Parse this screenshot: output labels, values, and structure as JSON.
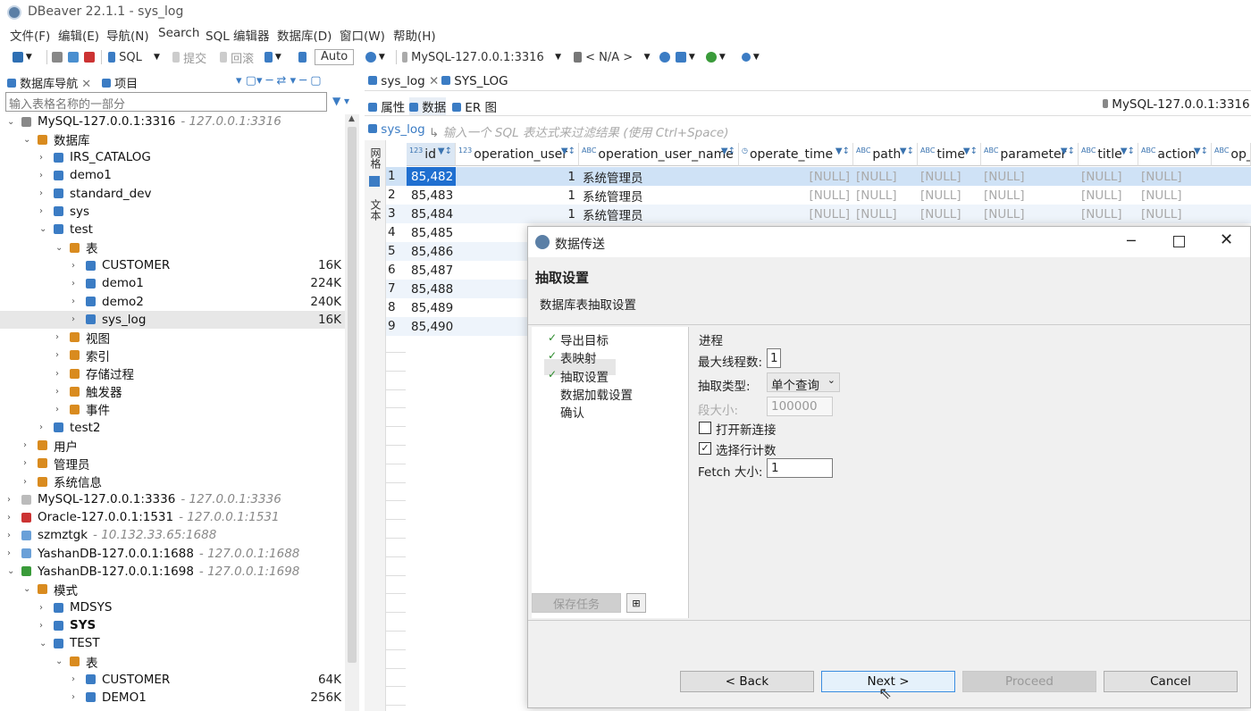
{
  "window": {
    "title": "DBeaver 22.1.1 - sys_log"
  },
  "menu": [
    "文件(F)",
    "编辑(E)",
    "导航(N)",
    "Search",
    "SQL 编辑器",
    "数据库(D)",
    "窗口(W)",
    "帮助(H)"
  ],
  "toolbar": {
    "sql_label": "SQL",
    "commit_label": "提交",
    "rollback_label": "回滚",
    "auto_label": "Auto",
    "connection": "MySQL-127.0.0.1:3316",
    "schema": "< N/A >"
  },
  "navigator": {
    "tab_db": "数据库导航",
    "tab_project": "项目",
    "search_placeholder": "输入表格名称的一部分",
    "tree": [
      {
        "label": "MySQL-127.0.0.1:3316",
        "host": "- 127.0.0.1:3316",
        "size": "",
        "selected": false
      },
      {
        "label": "数据库",
        "host": "",
        "size": "",
        "selected": false
      },
      {
        "label": "IRS_CATALOG",
        "host": "",
        "size": "",
        "selected": false
      },
      {
        "label": "demo1",
        "host": "",
        "size": "",
        "selected": false
      },
      {
        "label": "standard_dev",
        "host": "",
        "size": "",
        "selected": false
      },
      {
        "label": "sys",
        "host": "",
        "size": "",
        "selected": false
      },
      {
        "label": "test",
        "host": "",
        "size": "",
        "selected": false
      },
      {
        "label": "表",
        "host": "",
        "size": "",
        "selected": false
      },
      {
        "label": "CUSTOMER",
        "host": "",
        "size": "16K",
        "selected": false
      },
      {
        "label": "demo1",
        "host": "",
        "size": "224K",
        "selected": false
      },
      {
        "label": "demo2",
        "host": "",
        "size": "240K",
        "selected": false
      },
      {
        "label": "sys_log",
        "host": "",
        "size": "16K",
        "selected": true
      },
      {
        "label": "视图",
        "host": "",
        "size": "",
        "selected": false
      },
      {
        "label": "索引",
        "host": "",
        "size": "",
        "selected": false
      },
      {
        "label": "存储过程",
        "host": "",
        "size": "",
        "selected": false
      },
      {
        "label": "触发器",
        "host": "",
        "size": "",
        "selected": false
      },
      {
        "label": "事件",
        "host": "",
        "size": "",
        "selected": false
      },
      {
        "label": "test2",
        "host": "",
        "size": "",
        "selected": false
      },
      {
        "label": "用户",
        "host": "",
        "size": "",
        "selected": false
      },
      {
        "label": "管理员",
        "host": "",
        "size": "",
        "selected": false
      },
      {
        "label": "系统信息",
        "host": "",
        "size": "",
        "selected": false
      },
      {
        "label": "MySQL-127.0.0.1:3336",
        "host": "- 127.0.0.1:3336",
        "size": "",
        "selected": false
      },
      {
        "label": "Oracle-127.0.0.1:1531",
        "host": "- 127.0.0.1:1531",
        "size": "",
        "selected": false
      },
      {
        "label": "szmztgk",
        "host": "- 10.132.33.65:1688",
        "size": "",
        "selected": false
      },
      {
        "label": "YashanDB-127.0.0.1:1688",
        "host": "- 127.0.0.1:1688",
        "size": "",
        "selected": false
      },
      {
        "label": "YashanDB-127.0.0.1:1698",
        "host": "- 127.0.0.1:1698",
        "size": "",
        "selected": false
      },
      {
        "label": "模式",
        "host": "",
        "size": "",
        "selected": false
      },
      {
        "label": "MDSYS",
        "host": "",
        "size": "",
        "selected": false
      },
      {
        "label": "SYS",
        "host": "",
        "size": "",
        "selected": false
      },
      {
        "label": "TEST",
        "host": "",
        "size": "",
        "selected": false
      },
      {
        "label": "表",
        "host": "",
        "size": "",
        "selected": false
      },
      {
        "label": "CUSTOMER",
        "host": "",
        "size": "64K",
        "selected": false
      },
      {
        "label": "DEMO1",
        "host": "",
        "size": "256K",
        "selected": false
      }
    ]
  },
  "editor": {
    "tabs": [
      "sys_log",
      "SYS_LOG"
    ],
    "subtabs": [
      "属性",
      "数据",
      "ER 图"
    ],
    "connection_label": "MySQL-127.0.0.1:3316",
    "table_label": "sys_log",
    "filter_placeholder": "输入一个 SQL 表达式来过滤结果 (使用 Ctrl+Space)",
    "side_tabs": [
      "网格",
      "文本"
    ],
    "columns": [
      "id",
      "operation_user",
      "operation_user_name",
      "operate_time",
      "path",
      "time",
      "parameter",
      "title",
      "action",
      "op_t"
    ],
    "rows": [
      {
        "n": "1",
        "id": "85,482",
        "user": "1",
        "name": "系统管理员"
      },
      {
        "n": "2",
        "id": "85,483",
        "user": "1",
        "name": "系统管理员"
      },
      {
        "n": "3",
        "id": "85,484",
        "user": "1",
        "name": "系统管理员"
      },
      {
        "n": "4",
        "id": "85,485",
        "user": "",
        "name": ""
      },
      {
        "n": "5",
        "id": "85,486",
        "user": "",
        "name": ""
      },
      {
        "n": "6",
        "id": "85,487",
        "user": "",
        "name": ""
      },
      {
        "n": "7",
        "id": "85,488",
        "user": "",
        "name": ""
      },
      {
        "n": "8",
        "id": "85,489",
        "user": "",
        "name": ""
      },
      {
        "n": "9",
        "id": "85,490",
        "user": "",
        "name": ""
      }
    ],
    "null_text": "[NULL]"
  },
  "dialog": {
    "title": "数据传送",
    "heading": "抽取设置",
    "subheading": "数据库表抽取设置",
    "steps": [
      {
        "label": "导出目标",
        "done": true
      },
      {
        "label": "表映射",
        "done": true
      },
      {
        "label": "抽取设置",
        "done": true
      },
      {
        "label": "数据加载设置",
        "done": false
      },
      {
        "label": "确认",
        "done": false
      }
    ],
    "group_label": "进程",
    "max_threads_label": "最大线程数:",
    "max_threads_value": "1",
    "extract_type_label": "抽取类型:",
    "extract_type_value": "单个查询",
    "segment_label": "段大小:",
    "segment_value": "100000",
    "open_conn_label": "打开新连接",
    "select_count_label": "选择行计数",
    "fetch_label": "Fetch 大小:",
    "fetch_value": "1",
    "save_task_label": "保存任务",
    "back_label": "< Back",
    "next_label": "Next >",
    "proceed_label": "Proceed",
    "cancel_label": "Cancel"
  }
}
